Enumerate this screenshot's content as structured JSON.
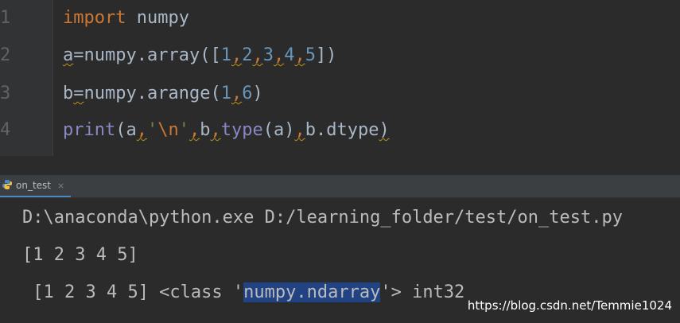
{
  "editor": {
    "line_numbers": [
      "1",
      "2",
      "3",
      "4"
    ],
    "line1": {
      "kw": "import",
      "rest": " numpy"
    },
    "line2": {
      "a": "a",
      "eq": "=",
      "fn": "numpy.array([",
      "n1": "1",
      "c1": ",",
      "n2": "2",
      "c2": ",",
      "n3": "3",
      "c3": ",",
      "n4": "4",
      "c4": ",",
      "n5": "5",
      "end": "])"
    },
    "line3": {
      "b": "b",
      "eq": "=",
      "fn": "numpy.arange(",
      "n1": "1",
      "c1": ",",
      "n2": "6",
      "end": ")"
    },
    "line4": {
      "print": "print",
      "p1": "(a",
      "c1": ",",
      "str_q1": "'",
      "str_esc": "\\n",
      "str_q2": "'",
      "c2": ",",
      "b": "b",
      "c3": ",",
      "type": "type",
      "p2": "(a)",
      "c4": ",",
      "tail": "b.dtype",
      "close": ")"
    }
  },
  "run_tab": {
    "label": "on_test",
    "close": "×"
  },
  "console": {
    "line1": "D:\\anaconda\\python.exe D:/learning_folder/test/on_test.py",
    "line2": "[1 2 3 4 5]",
    "line3_pre": " [1 2 3 4 5] <class '",
    "line3_sel": "numpy.ndarray",
    "line3_post": "'> int32"
  },
  "watermark": "https://blog.csdn.net/Temmie1024",
  "colors": {
    "background": "#2b2b2b",
    "keyword": "#cc7832",
    "number": "#6897bb",
    "builtin": "#8888c6",
    "selection": "#214283"
  }
}
